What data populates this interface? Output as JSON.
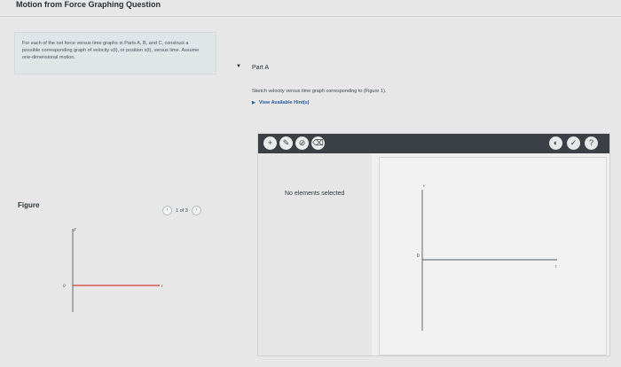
{
  "page_title": "Motion from Force Graphing Question",
  "intro": {
    "text": "For each of the net force versus time graphs in Parts A, B, and C, construct a possible corresponding graph of velocity v(t), or position x(t), versus time. Assume one-dimensional motion."
  },
  "figure": {
    "label": "Figure",
    "pager_text": "1 of 3",
    "graph": {
      "y_label": "F",
      "origin_label": "0",
      "x_label": "t",
      "line_color": "#d43a3a"
    }
  },
  "part": {
    "label": "Part A",
    "instruction": "Sketch velocity versus time graph corresponding to (Figure 1).",
    "hint_link": "View Available Hint(s)"
  },
  "tool_panel": {
    "status": "No elements selected",
    "tools_left": [
      "+",
      "✎",
      "⊘",
      "⌫"
    ],
    "tools_right": [
      "◐",
      "✓",
      "?"
    ],
    "graph": {
      "y_label": "v",
      "origin_label": "0",
      "x_label": "t"
    }
  },
  "colors": {
    "toolbar": "#3a4046",
    "hint": "#2a5a9c",
    "figure_line": "#d43a3a"
  }
}
